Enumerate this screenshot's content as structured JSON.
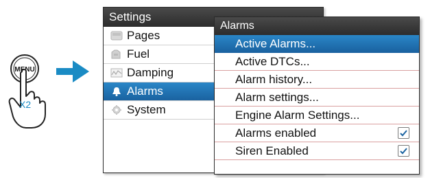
{
  "illustration": {
    "button_label": "MENU",
    "press_count": "X2",
    "button_icon": "menu-button-icon",
    "hand_icon": "pointing-hand-icon",
    "arrow_icon": "arrow-right-icon",
    "accent_color": "#1a8bc4"
  },
  "settings": {
    "title": "Settings",
    "items": [
      {
        "label": "Pages",
        "icon": "pages-icon",
        "selected": false
      },
      {
        "label": "Fuel",
        "icon": "fuel-icon",
        "selected": false
      },
      {
        "label": "Damping",
        "icon": "damping-icon",
        "selected": false
      },
      {
        "label": "Alarms",
        "icon": "bell-icon",
        "selected": true
      },
      {
        "label": "System",
        "icon": "gear-icon",
        "selected": false
      }
    ]
  },
  "alarms": {
    "title": "Alarms",
    "items": [
      {
        "label": "Active Alarms...",
        "selected": true
      },
      {
        "label": "Active DTCs...",
        "selected": false
      },
      {
        "label": "Alarm history...",
        "selected": false
      },
      {
        "label": "Alarm settings...",
        "selected": false
      },
      {
        "label": "Engine Alarm Settings...",
        "selected": false
      },
      {
        "label": "Alarms enabled",
        "selected": false,
        "checked": true
      },
      {
        "label": "Siren Enabled",
        "selected": false,
        "checked": true
      }
    ]
  },
  "colors": {
    "selection": "#1f6fa8",
    "header": "#333333",
    "check": "#1a62a0"
  }
}
